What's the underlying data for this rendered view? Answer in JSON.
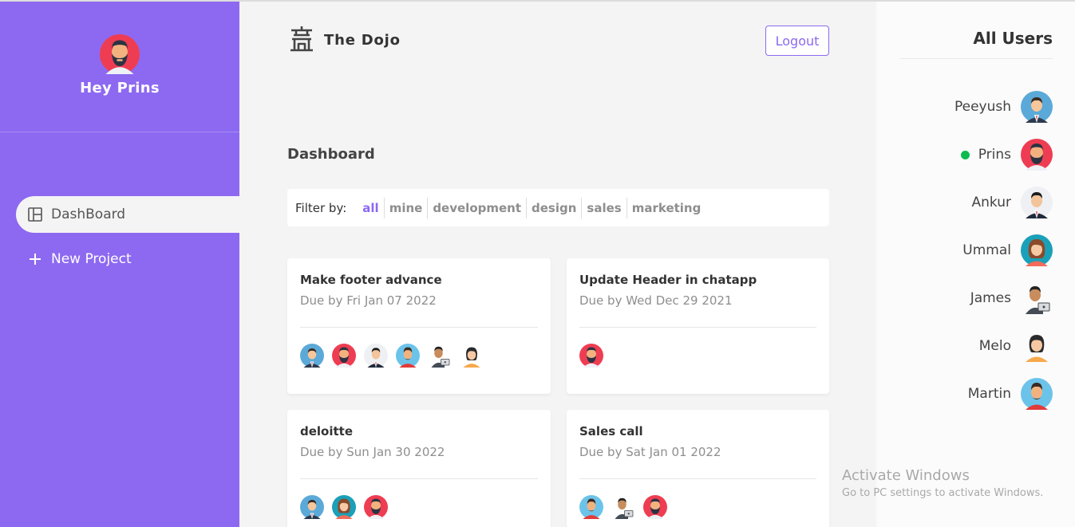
{
  "sidebar": {
    "greeting": "Hey Prins",
    "nav": [
      {
        "label": "DashBoard",
        "icon": "dashboard-icon",
        "active": true
      },
      {
        "label": "New Project",
        "icon": "plus-icon",
        "active": false
      }
    ]
  },
  "header": {
    "brand": "The Dojo",
    "logo_icon": "temple-icon",
    "logout_label": "Logout"
  },
  "main": {
    "title": "Dashboard",
    "filter": {
      "label": "Filter by:",
      "options": [
        "all",
        "mine",
        "development",
        "design",
        "sales",
        "marketing"
      ],
      "active": "all"
    },
    "projects": [
      {
        "title": "Make footer advance",
        "due": "Due by Fri Jan 07 2022",
        "assignees": [
          "Peeyush",
          "Prins",
          "Ankur",
          "Martin",
          "James",
          "Melo"
        ]
      },
      {
        "title": "Update Header in chatapp",
        "due": "Due by Wed Dec 29 2021",
        "assignees": [
          "Prins"
        ]
      },
      {
        "title": "deloitte",
        "due": "Due by Sun Jan 30 2022",
        "assignees": [
          "Peeyush",
          "Ummal",
          "Prins"
        ]
      },
      {
        "title": "Sales call",
        "due": "Due by Sat Jan 01 2022",
        "assignees": [
          "Martin",
          "James",
          "Prins"
        ]
      }
    ]
  },
  "users_panel": {
    "title": "All Users",
    "users": [
      {
        "name": "Peeyush",
        "online": false
      },
      {
        "name": "Prins",
        "online": true
      },
      {
        "name": "Ankur",
        "online": false
      },
      {
        "name": "Ummal",
        "online": false
      },
      {
        "name": "James",
        "online": false
      },
      {
        "name": "Melo",
        "online": false
      },
      {
        "name": "Martin",
        "online": false
      }
    ]
  },
  "watermark": {
    "title": "Activate Windows",
    "subtitle": "Go to PC settings to activate Windows."
  },
  "colors": {
    "accent": "#8d69f1",
    "online": "#0ebb50",
    "background": "#f4f4f4"
  }
}
